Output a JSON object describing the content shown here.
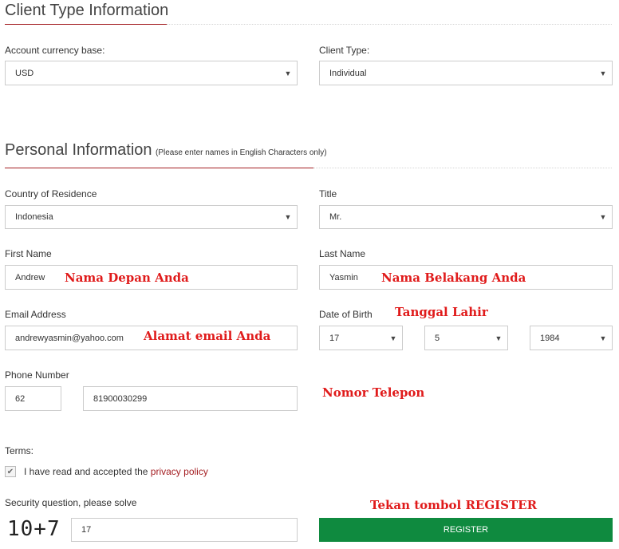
{
  "client_type": {
    "title": "Client Type Information",
    "currency_label": "Account currency base:",
    "currency_value": "USD",
    "client_type_label": "Client Type:",
    "client_type_value": "Individual"
  },
  "personal": {
    "title": "Personal Information",
    "note": "(Please enter names in English Characters only)",
    "country_label": "Country of Residence",
    "country_value": "Indonesia",
    "title_label": "Title",
    "title_value": "Mr.",
    "first_name_label": "First Name",
    "first_name_value": "Andrew",
    "last_name_label": "Last Name",
    "last_name_value": "Yasmin",
    "email_label": "Email Address",
    "email_value": "andrewyasmin@yahoo.com",
    "dob_label": "Date of Birth",
    "dob_day": "17",
    "dob_month": "5",
    "dob_year": "1984",
    "phone_label": "Phone Number",
    "phone_code": "62",
    "phone_number": "81900030299"
  },
  "terms": {
    "label": "Terms:",
    "text": "I have read and accepted the ",
    "link": "privacy policy"
  },
  "security": {
    "label": "Security question, please solve",
    "question": "10+7",
    "answer": "17"
  },
  "register_label": "REGISTER",
  "annotations": {
    "first_name": "Nama Depan Anda",
    "last_name": "Nama Belakang Anda",
    "dob": "Tanggal Lahir",
    "email": "Alamat email Anda",
    "phone": "Nomor Telepon",
    "register": "Tekan tombol REGISTER"
  },
  "colors": {
    "accent_red": "#a41e22",
    "annotation_red": "#e01b1b",
    "register_green": "#0f8a3f"
  },
  "icons": {
    "select_caret": "chevron-down-icon",
    "checkbox": "check-icon"
  }
}
